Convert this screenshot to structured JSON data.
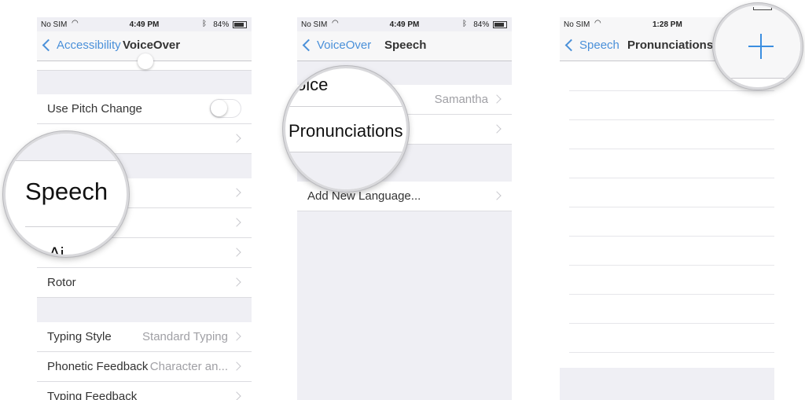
{
  "screen1": {
    "status": {
      "carrier": "No SIM",
      "time": "4:49 PM",
      "battery": "84%"
    },
    "nav": {
      "back": "Accessibility",
      "title": "VoiceOver"
    },
    "rows": {
      "pitch": "Use Pitch Change",
      "rotor": "Rotor",
      "typing_style": "Typing Style",
      "typing_style_value": "Standard Typing",
      "phonetic": "Phonetic Feedback",
      "phonetic_value": "Character an...",
      "typing_feedback": "Typing Feedback"
    },
    "magnifier": {
      "text": "Speech",
      "partial": "Ai"
    }
  },
  "screen2": {
    "status": {
      "carrier": "No SIM",
      "time": "4:49 PM",
      "battery": "84%"
    },
    "nav": {
      "back": "VoiceOver",
      "title": "Speech"
    },
    "rows": {
      "voice_value": "Samantha",
      "add_language": "Add New Language..."
    },
    "magnifier": {
      "voice": "oice",
      "pronunciations": "Pronunciations"
    }
  },
  "screen3": {
    "status": {
      "carrier": "No SIM",
      "time": "1:28 PM"
    },
    "nav": {
      "back": "Speech",
      "title": "Pronunciations"
    },
    "magnifier": {
      "icon": "plus-icon"
    }
  },
  "colors": {
    "accent": "#4a90d9",
    "background": "#efeff4"
  }
}
